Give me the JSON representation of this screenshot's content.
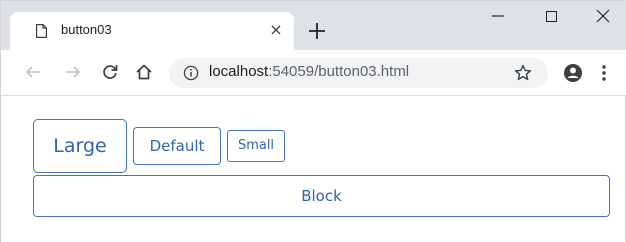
{
  "browser": {
    "tab": {
      "title": "button03",
      "close_glyph": "×"
    },
    "new_tab_glyph": "+",
    "window_controls": {
      "minimize": "—",
      "maximize": "☐",
      "close": "✕"
    },
    "toolbar": {
      "back_icon": "back-arrow-icon",
      "forward_icon": "forward-arrow-icon",
      "reload_icon": "reload-icon",
      "home_icon": "home-icon",
      "url_host": "localhost",
      "url_rest": ":54059/button03.html",
      "info_icon": "info-icon",
      "star_icon": "star-icon",
      "profile_icon": "profile-icon",
      "menu_icon": "kebab-menu-icon"
    }
  },
  "page": {
    "buttons": {
      "large": "Large",
      "default": "Default",
      "small": "Small",
      "block": "Block"
    }
  },
  "colors": {
    "tabstrip_bg": "#dee1e6",
    "omnibox_bg": "#f1f3f4",
    "button_border": "#3f72c8",
    "button_text": "#2f63b9"
  }
}
